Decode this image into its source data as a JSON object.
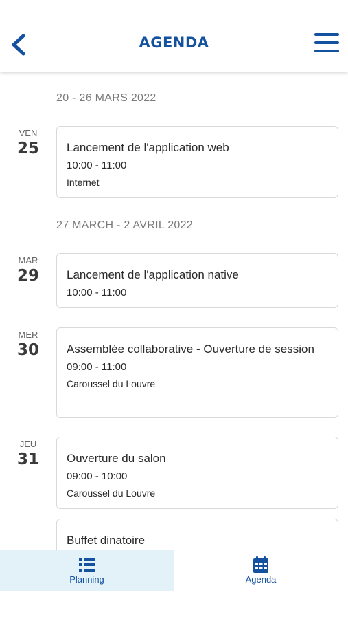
{
  "header": {
    "title": "AGENDA",
    "back_icon": "chevron-left-icon",
    "menu_icon": "hamburger-menu-icon"
  },
  "colors": {
    "primary": "#1452a0",
    "active_tab_bg": "#e2f2f8"
  },
  "weeks": [
    {
      "label": "20 - 26 MARS 2022"
    },
    {
      "label": "27 MARCH - 2 AVRIL 2022"
    }
  ],
  "days": [
    {
      "name": "VEN",
      "num": "25"
    },
    {
      "name": "MAR",
      "num": "29"
    },
    {
      "name": "MER",
      "num": "30"
    },
    {
      "name": "JEU",
      "num": "31"
    }
  ],
  "events": [
    {
      "title": "Lancement de l'application web",
      "time": "10:00 - 11:00",
      "place": "Internet"
    },
    {
      "title": "Lancement de l'application native",
      "time": "10:00 - 11:00"
    },
    {
      "title": "Assemblée collaborative - Ouverture de session",
      "time": "09:00 - 11:00",
      "place": "Caroussel du Louvre"
    },
    {
      "title": "Ouverture du salon",
      "time": "09:00 - 10:00",
      "place": "Caroussel du Louvre"
    },
    {
      "title": "Buffet dinatoire"
    }
  ],
  "tabs": [
    {
      "label": "Planning",
      "icon": "list-icon",
      "active": true
    },
    {
      "label": "Agenda",
      "icon": "calendar-icon",
      "active": false
    }
  ]
}
